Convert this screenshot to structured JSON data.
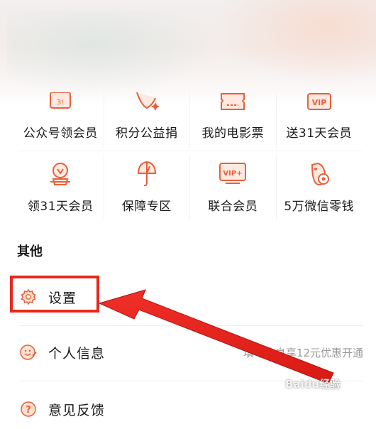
{
  "grid": {
    "row1": [
      {
        "label": "公众号领会员",
        "icon": "official-account-icon"
      },
      {
        "label": "积分公益捐",
        "icon": "heart-sparkle-icon"
      },
      {
        "label": "我的电影票",
        "icon": "ticket-icon"
      },
      {
        "label": "送31天会员",
        "icon": "vip-icon",
        "icon_text": "VIP"
      }
    ],
    "row2": [
      {
        "label": "领31天会员",
        "icon": "gift-icon"
      },
      {
        "label": "保障专区",
        "icon": "shield-umbrella-icon"
      },
      {
        "label": "联合会员",
        "icon": "vip-plus-icon",
        "icon_text": "VIP+"
      },
      {
        "label": "5万微信零钱",
        "icon": "coin-bag-icon"
      }
    ]
  },
  "other": {
    "title": "其他",
    "items": [
      {
        "label": "设置",
        "icon": "gear-icon"
      },
      {
        "label": "个人信息",
        "icon": "smile-edit-icon",
        "sub": "填写信息享12元优惠开通"
      },
      {
        "label": "意见反馈",
        "icon": "question-icon"
      }
    ]
  },
  "annotation": {
    "color": "#e8281d"
  },
  "watermark": "Baidu经验",
  "colors": {
    "accent": "#e8603a",
    "annotation": "#e8281d"
  }
}
